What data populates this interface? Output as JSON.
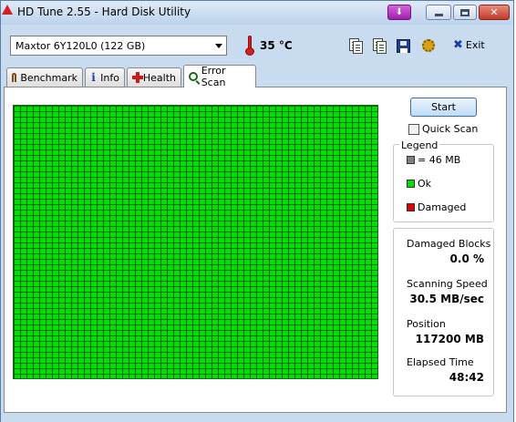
{
  "window": {
    "title": "HD Tune 2.55 - Hard Disk Utility"
  },
  "toolbar": {
    "drive": "Maxtor 6Y120L0 (122 GB)",
    "temperature": "35 °C",
    "exit_label": "Exit"
  },
  "tabs": [
    {
      "label": "Benchmark",
      "icon": "benchmark-icon"
    },
    {
      "label": "Info",
      "icon": "info-icon"
    },
    {
      "label": "Health",
      "icon": "health-cross-icon"
    },
    {
      "label": "Error Scan",
      "icon": "search-icon",
      "active": true
    }
  ],
  "scan": {
    "start_label": "Start",
    "quick_scan_label": "Quick Scan",
    "quick_scan_checked": false,
    "block_state": "all-ok",
    "colors": {
      "ok": "#00e000",
      "damaged": "#e00000",
      "block": "#808080"
    }
  },
  "legend": {
    "title": "Legend",
    "block_size": "= 46 MB",
    "ok": "Ok",
    "damaged": "Damaged"
  },
  "stats": {
    "damaged_blocks_label": "Damaged Blocks",
    "damaged_blocks_value": "0.0 %",
    "scanning_speed_label": "Scanning Speed",
    "scanning_speed_value": "30.5 MB/sec",
    "position_label": "Position",
    "position_value": "117200 MB",
    "elapsed_label": "Elapsed Time",
    "elapsed_value": "48:42"
  }
}
